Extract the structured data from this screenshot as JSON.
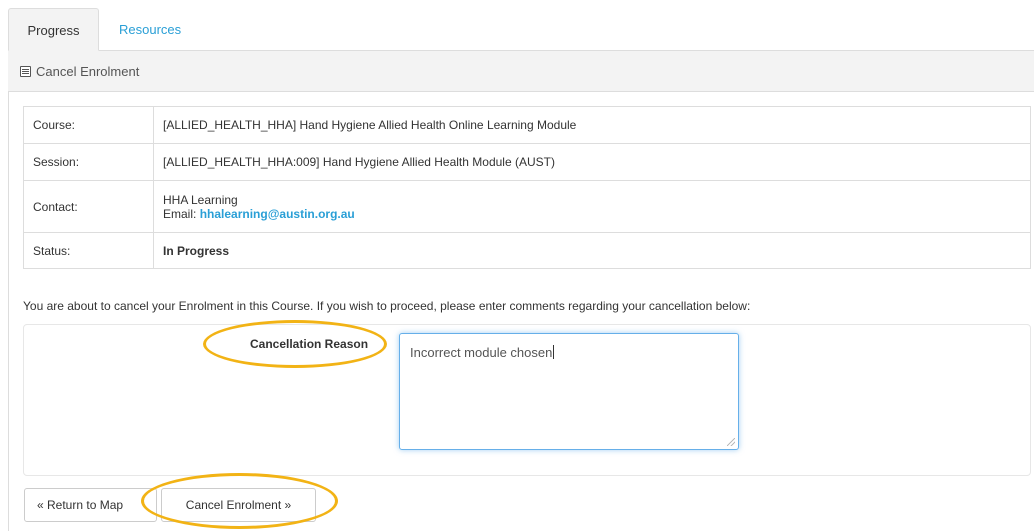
{
  "tabs": {
    "progress": "Progress",
    "resources": "Resources"
  },
  "panel": {
    "title": "Cancel Enrolment",
    "icon": "form-icon"
  },
  "details": {
    "course_label": "Course:",
    "course_value": "[ALLIED_HEALTH_HHA] Hand Hygiene Allied Health Online Learning Module",
    "session_label": "Session:",
    "session_value": "[ALLIED_HEALTH_HHA:009] Hand Hygiene Allied Health Module (AUST)",
    "contact_label": "Contact:",
    "contact_name": "HHA Learning",
    "email_prefix": "Email:",
    "email": "hhalearning@austin.org.au",
    "status_label": "Status:",
    "status_value": "In Progress"
  },
  "notice": "You are about to cancel your Enrolment in this Course. If you wish to proceed, please enter comments regarding your cancellation below:",
  "form": {
    "reason_label": "Cancellation Reason",
    "reason_value": "Incorrect module chosen"
  },
  "buttons": {
    "back": "« Return to Map",
    "cancel": "Cancel Enrolment »"
  },
  "colors": {
    "link": "#2a9fd6",
    "highlight": "#f2b315",
    "focus": "#66afe9"
  }
}
